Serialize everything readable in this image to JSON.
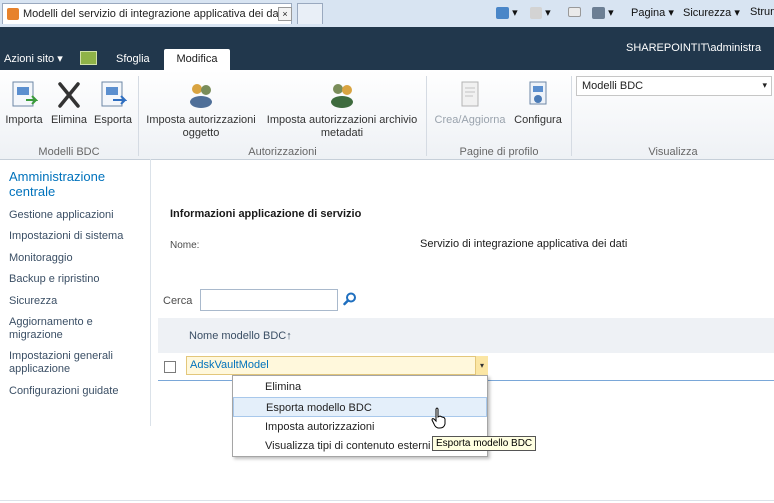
{
  "browser": {
    "tab_title": "Modelli del servizio di integrazione applicativa dei dati",
    "close_glyph": "×",
    "commands": {
      "page": "Pagina",
      "security": "Sicurezza",
      "tools": "Strum"
    },
    "dropdown_glyph": "▾"
  },
  "topbar": {
    "site_actions": "Azioni sito ▾",
    "tabs": [
      {
        "label": "Sfoglia"
      },
      {
        "label": "Modifica"
      }
    ],
    "user": "SHAREPOINTIT\\administra"
  },
  "ribbon": {
    "buttons": {
      "import": "Importa",
      "delete": "Elimina",
      "export": "Esporta",
      "object_permissions": "Imposta autorizzazioni oggetto",
      "metadata_permissions": "Imposta autorizzazioni archivio metadati",
      "create_update": "Crea/Aggiorna",
      "configure": "Configura"
    },
    "groups": {
      "bdc_models": "Modelli BDC",
      "permissions": "Autorizzazioni",
      "profile_pages": "Pagine di profilo",
      "view": "Visualizza"
    },
    "view_select": {
      "value": "Modelli BDC",
      "arrow": "▾"
    }
  },
  "leftnav": {
    "heading": "Amministrazione centrale",
    "items": [
      "Gestione applicazioni",
      "Impostazioni di sistema",
      "Monitoraggio",
      "Backup e ripristino",
      "Sicurezza",
      "Aggiornamento e migrazione",
      "Impostazioni generali applicazione",
      "Configurazioni guidate"
    ]
  },
  "main": {
    "section_title": "Informazioni applicazione di servizio",
    "name_label": "Nome:",
    "name_value": "Servizio di integrazione applicativa dei dati",
    "search_label": "Cerca",
    "search_value": "",
    "column_header": "Nome modello BDC↑",
    "rows": [
      {
        "name": "AdskVaultModel"
      }
    ]
  },
  "context_menu": {
    "items": [
      "Elimina",
      "Esporta modello BDC",
      "Imposta autorizzazioni",
      "Visualizza tipi di contenuto esterni"
    ],
    "hovered_index": 1
  },
  "tooltip": "Esporta modello BDC"
}
